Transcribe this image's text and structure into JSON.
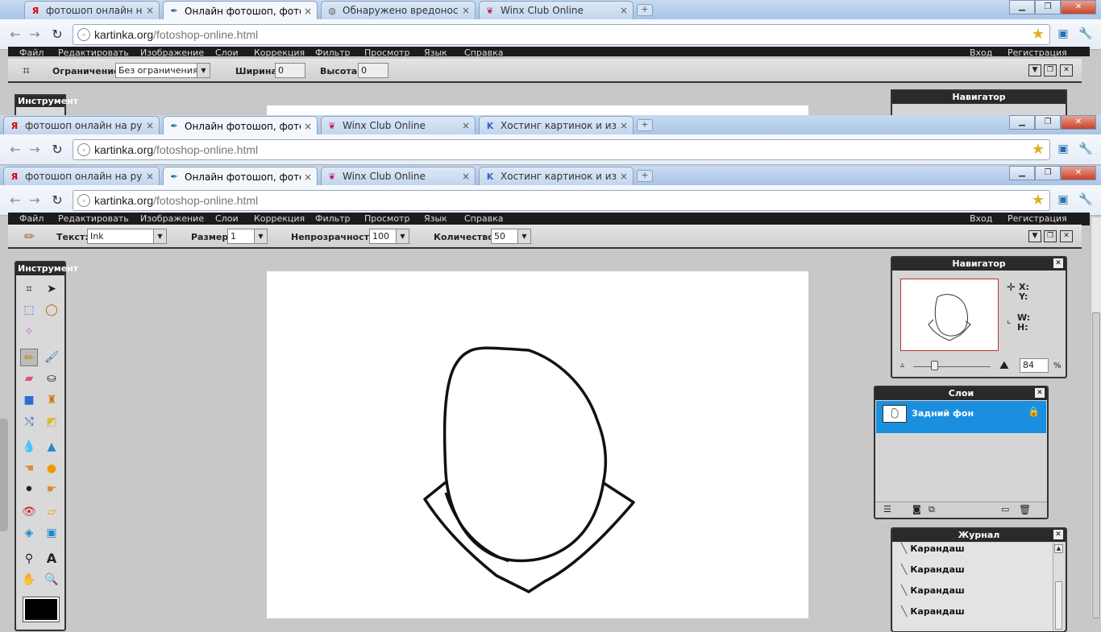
{
  "browser_layers": [
    {
      "tabs": [
        {
          "label": "фотошоп онлайн на русс",
          "icon": "yandex-icon"
        },
        {
          "label": "Онлайн фотошоп, фотош",
          "icon": "pen-feather-icon",
          "active": true
        },
        {
          "label": "Обнаружено вредоносное",
          "icon": "globe-icon"
        },
        {
          "label": "Winx Club Online",
          "icon": "winx-icon"
        }
      ],
      "url_domain": "kartinka.org",
      "url_path": "/fotoshop-online.html"
    },
    {
      "tabs": [
        {
          "label": "фотошоп онлайн на русс",
          "icon": "yandex-icon"
        },
        {
          "label": "Онлайн фотошоп, фотош",
          "icon": "pen-feather-icon",
          "active": true
        },
        {
          "label": "Winx Club Online",
          "icon": "winx-icon"
        },
        {
          "label": "Хостинг картинок и изобр",
          "icon": "k-icon"
        }
      ],
      "url_domain": "kartinka.org",
      "url_path": "/fotoshop-online.html"
    },
    {
      "tabs": [
        {
          "label": "фотошоп онлайн на русс",
          "icon": "yandex-icon"
        },
        {
          "label": "Онлайн фотошоп, фотош",
          "icon": "pen-feather-icon",
          "active": true
        },
        {
          "label": "Winx Club Online",
          "icon": "winx-icon"
        },
        {
          "label": "Хостинг картинок и изобр",
          "icon": "k-icon"
        }
      ],
      "url_domain": "kartinka.org",
      "url_path": "/fotoshop-online.html"
    }
  ],
  "menu": {
    "items": [
      "Файл",
      "Редактировать",
      "Изображение",
      "Слои",
      "Коррекция",
      "Фильтр",
      "Просмотр",
      "Язык",
      "Справка"
    ],
    "login": "Вход",
    "register": "Регистрация"
  },
  "crop_toolbar": {
    "constraint_label": "Ограничение:",
    "constraint_value": "Без ограничения",
    "width_label": "Ширина:",
    "width_value": "0",
    "height_label": "Высота:",
    "height_value": "0"
  },
  "pencil_toolbar": {
    "text_label": "Текст:",
    "text_value": "Ink",
    "size_label": "Размер:",
    "size_value": "1",
    "opacity_label": "Непрозрачность:",
    "opacity_value": "100",
    "count_label": "Количество:",
    "count_value": "50"
  },
  "tools_panel": {
    "title": "Инструмент"
  },
  "navigator": {
    "title": "Навигатор",
    "x_label": "X:",
    "y_label": "Y:",
    "w_label": "W:",
    "h_label": "H:",
    "zoom": "84",
    "zoom_unit": "%"
  },
  "layers": {
    "title": "Слои",
    "items": [
      {
        "name": "Задний фон",
        "locked": true
      }
    ]
  },
  "history": {
    "title": "Журнал",
    "items": [
      "Карандаш",
      "Карандаш",
      "Карандаш",
      "Карандаш"
    ]
  },
  "colors": {
    "menubar": "#1c1c1c",
    "layer_selected": "#1a8fdf",
    "tab_strip": "#b8cfeb"
  }
}
